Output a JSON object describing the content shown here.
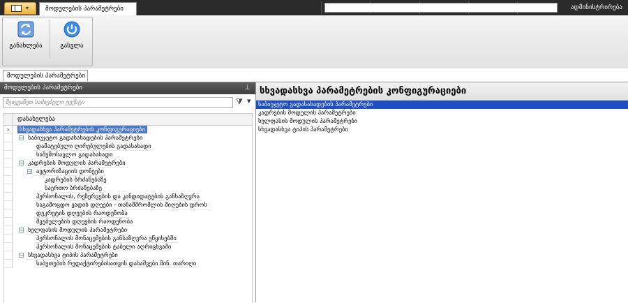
{
  "titlebar": {
    "tab_label": "მოდულების პარამეტრები",
    "user_label": "ადმინისტრირება",
    "search_value": ""
  },
  "ribbon": {
    "buttons": [
      {
        "label": "განახლება",
        "icon": "refresh-icon"
      },
      {
        "label": "გასვლა",
        "icon": "power-icon"
      }
    ]
  },
  "page_tab": {
    "label": "მოდულების პარამეტრები"
  },
  "left_panel": {
    "title": "მოდულების პარამეტრები",
    "filter_placeholder": "შეიყვანეთ საძიებელი ტექსტი",
    "column_header": "დასახელება",
    "rows": [
      {
        "text": "სხვადასხვა პარამეტრების კონფიგურაციები",
        "level": 0,
        "expander": "",
        "selected": true
      },
      {
        "text": "საბიუჯეტო გადასახადების პარამეტრები",
        "level": 1,
        "expander": "−"
      },
      {
        "text": "დამატებული ღირებულების გადასახადი",
        "level": 2,
        "expander": ""
      },
      {
        "text": "საშემოსავლო გადასახადი",
        "level": 2,
        "expander": ""
      },
      {
        "text": "კადრების მოდულის პარამეტრები",
        "level": 1,
        "expander": "−"
      },
      {
        "text": "ავტორიზაციის დონეები",
        "level": 2,
        "expander": "−"
      },
      {
        "text": "კადრების ბრძანებაზე",
        "level": 3,
        "expander": ""
      },
      {
        "text": "საერთო ბრძანებაზე",
        "level": 3,
        "expander": ""
      },
      {
        "text": "პერსონალის, რეზერვების და კანდიდატების განსაზღვრა",
        "level": 2,
        "expander": ""
      },
      {
        "text": "საგამოცდო ვადის დღეები - თანამშრომლის მიღების დროს",
        "level": 2,
        "expander": ""
      },
      {
        "text": "დეკრეტის დღეების რაოდენობა",
        "level": 2,
        "expander": ""
      },
      {
        "text": "შვებულების დღეების რაოდენობა",
        "level": 2,
        "expander": ""
      },
      {
        "text": "ხელფასის მოდულის პარამეტრები",
        "level": 1,
        "expander": "−"
      },
      {
        "text": "პერსონალის მონაცემების განსაზღვრა უწყისებში",
        "level": 2,
        "expander": ""
      },
      {
        "text": "პერსონალის მონაცემების ტაბელი აღრიცხვაში",
        "level": 2,
        "expander": ""
      },
      {
        "text": "სხვადასხვა ტიპის პარამეტრები",
        "level": 1,
        "expander": "−"
      },
      {
        "text": "საბუთების რედაქტირებისათვის დასაშვები მინ. თარიღი",
        "level": 2,
        "expander": ""
      }
    ]
  },
  "right_panel": {
    "title": "სხვადასხვა პარამეტრების კონფიგურაციები",
    "items": [
      {
        "text": "საბიუჯეტო გადასახადების პარამეტრები",
        "selected": true
      },
      {
        "text": "კადრების მოდულის პარამეტრები",
        "selected": false
      },
      {
        "text": "ხელფასის მოდულის პარამეტრები",
        "selected": false
      },
      {
        "text": "სხვადასხვა ტიპის პარამეტრები",
        "selected": false
      }
    ]
  },
  "colors": {
    "selection": "#4a78c8",
    "list_selection": "#1f4fbf",
    "header_dark": "#3e3e3e"
  }
}
